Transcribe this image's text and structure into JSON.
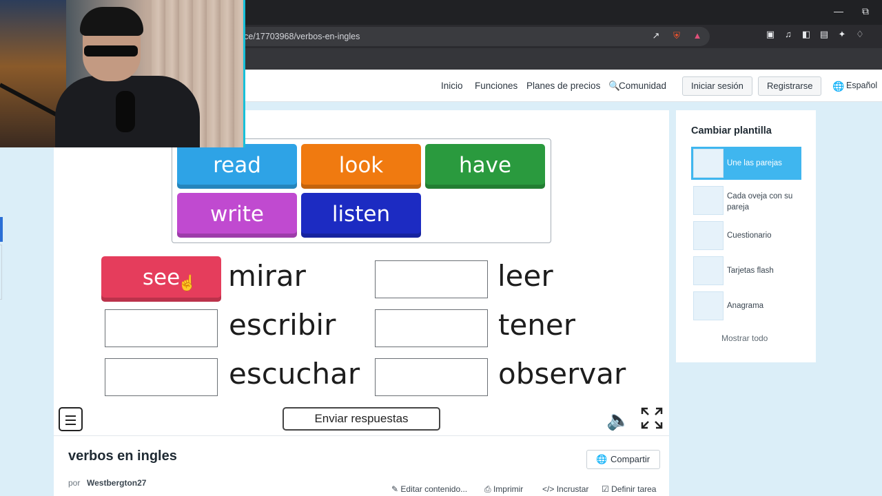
{
  "browser": {
    "url": "rce/17703968/verbos-en-ingles",
    "window_controls": [
      "minimize",
      "restore"
    ]
  },
  "nav": {
    "links": [
      "Inicio",
      "Funciones",
      "Planes de precios",
      "Comunidad"
    ],
    "login": "Iniciar sesión",
    "register": "Registrarse",
    "language": "Español"
  },
  "activity": {
    "word_bank": [
      "read",
      "look",
      "have",
      "write",
      "listen"
    ],
    "placed_tile": "see",
    "targets": [
      {
        "word": "mirar",
        "answer": "see"
      },
      {
        "word": "leer",
        "answer": ""
      },
      {
        "word": "escribir",
        "answer": ""
      },
      {
        "word": "tener",
        "answer": ""
      },
      {
        "word": "escuchar",
        "answer": ""
      },
      {
        "word": "observar",
        "answer": ""
      }
    ],
    "submit_label": "Enviar respuestas"
  },
  "colors": {
    "read": "#2ea3e6",
    "look": "#f07a10",
    "have": "#2a9a3e",
    "write": "#c04ad0",
    "listen": "#1c2bc2",
    "see": "#e53d5c",
    "accent": "#3fb6ef"
  },
  "info": {
    "title": "verbos en ingles",
    "by_label": "por",
    "author": "Westbergton27",
    "share": "Compartir",
    "actions": [
      "Editar contenido...",
      "Imprimir",
      "Incrustar",
      "Definir tarea"
    ]
  },
  "sidebar": {
    "title": "Cambiar plantilla",
    "templates": [
      {
        "label": "Une las parejas",
        "active": true
      },
      {
        "label": "Cada oveja con su pareja",
        "active": false
      },
      {
        "label": "Cuestionario",
        "active": false
      },
      {
        "label": "Tarjetas flash",
        "active": false
      },
      {
        "label": "Anagrama",
        "active": false
      }
    ],
    "show_all": "Mostrar todo"
  },
  "icons": [
    "share-icon",
    "brave-shield-icon",
    "rewards-icon",
    "music-icon",
    "sidebar-icon",
    "wallet-icon",
    "leo-icon",
    "vpn-icon",
    "globe-icon",
    "search-icon",
    "menu-icon",
    "speaker-icon",
    "fullscreen-icon",
    "edit-icon",
    "print-icon",
    "embed-icon",
    "checkbox-icon"
  ]
}
